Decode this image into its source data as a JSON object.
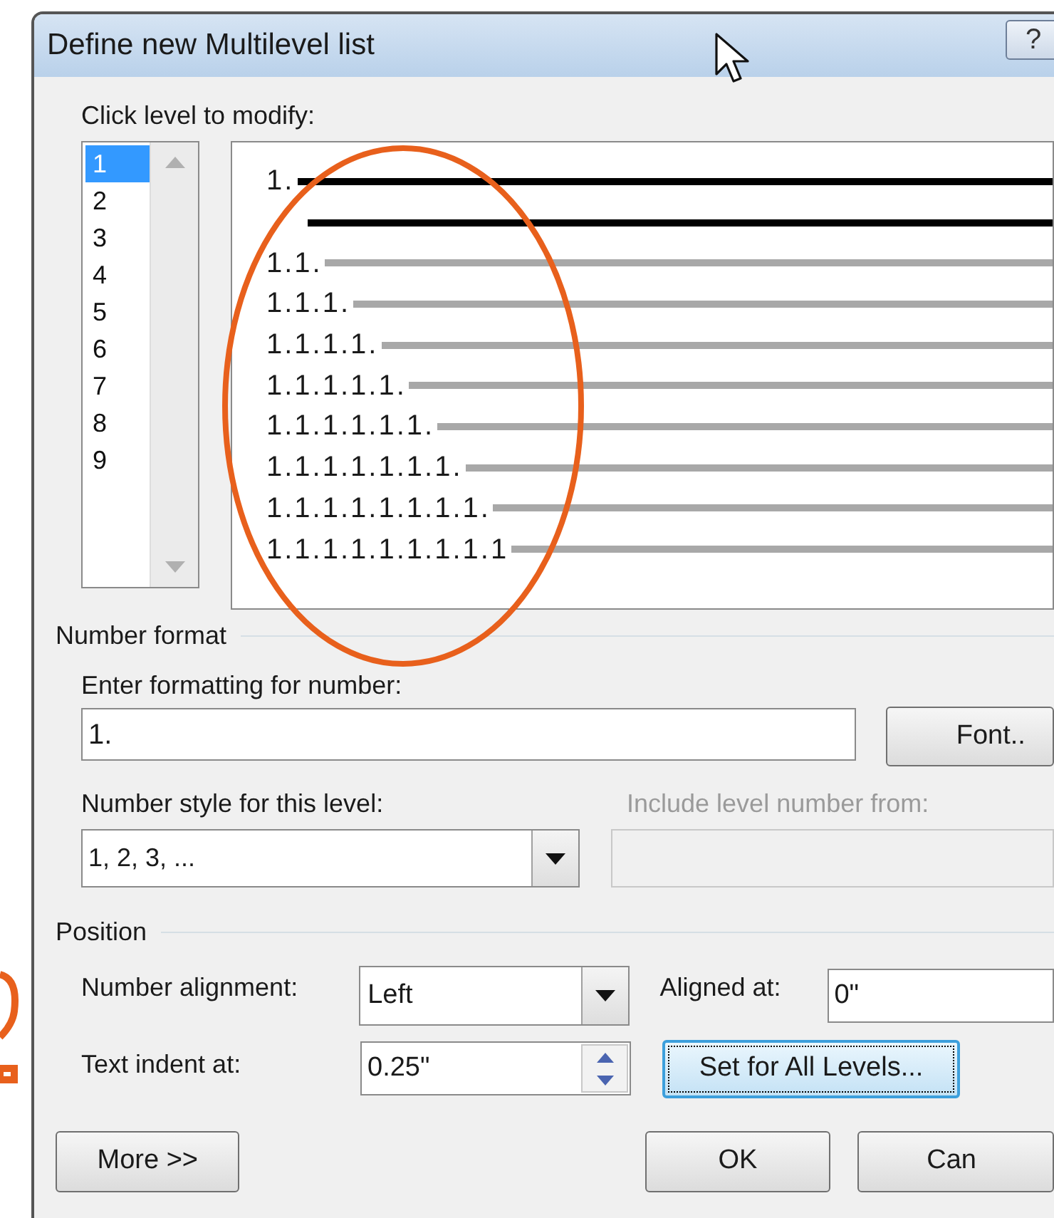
{
  "window": {
    "title": "Define new Multilevel list",
    "help_button": "?"
  },
  "level_list": {
    "label": "Click level to modify:",
    "items": [
      {
        "label": "1",
        "selected": true
      },
      {
        "label": "2",
        "selected": false
      },
      {
        "label": "3",
        "selected": false
      },
      {
        "label": "4",
        "selected": false
      },
      {
        "label": "5",
        "selected": false
      },
      {
        "label": "6",
        "selected": false
      },
      {
        "label": "7",
        "selected": false
      },
      {
        "label": "8",
        "selected": false
      },
      {
        "label": "9",
        "selected": false
      }
    ]
  },
  "preview": {
    "rows": [
      {
        "kind": "current",
        "label": "1."
      },
      {
        "kind": "current"
      },
      {
        "kind": "other",
        "label": "1.1."
      },
      {
        "kind": "other",
        "label": "1.1.1."
      },
      {
        "kind": "other",
        "label": "1.1.1.1."
      },
      {
        "kind": "other",
        "label": "1.1.1.1.1."
      },
      {
        "kind": "other",
        "label": "1.1.1.1.1.1."
      },
      {
        "kind": "other",
        "label": "1.1.1.1.1.1.1."
      },
      {
        "kind": "other",
        "label": "1.1.1.1.1.1.1.1."
      },
      {
        "kind": "other",
        "label": "1.1.1.1.1.1.1.1.1"
      }
    ]
  },
  "number_format": {
    "title": "Number format",
    "format_field": {
      "label": "Enter formatting for number:",
      "value": "1."
    },
    "font_button": "Font..",
    "number_style": {
      "label": "Number style for this level:",
      "value": "1, 2, 3, ..."
    },
    "include_level": {
      "label": "Include level number from:",
      "disabled": true
    }
  },
  "position": {
    "title": "Position",
    "number_alignment": {
      "label": "Number alignment:",
      "value": "Left"
    },
    "aligned_at": {
      "label": "Aligned at:",
      "value": "0\""
    },
    "text_indent": {
      "label": "Text indent at:",
      "value": "0.25\""
    },
    "set_all_button": {
      "label": "Set for All Levels...",
      "focused": true
    }
  },
  "buttons": [
    "More >>",
    "OK",
    "Can"
  ]
}
